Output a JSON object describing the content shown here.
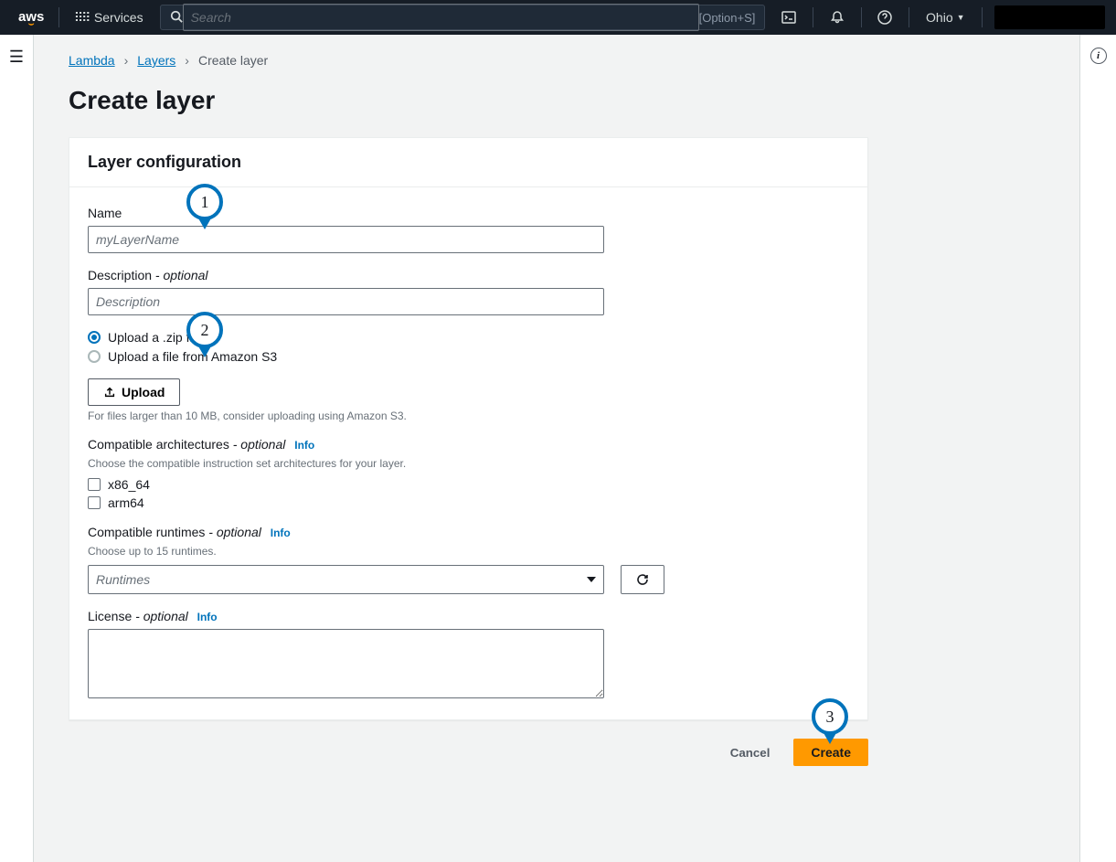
{
  "nav": {
    "services": "Services",
    "search_placeholder": "Search",
    "search_kbd": "[Option+S]",
    "region": "Ohio"
  },
  "breadcrumb": {
    "lambda": "Lambda",
    "layers": "Layers",
    "current": "Create layer"
  },
  "page_title": "Create layer",
  "panel": {
    "title": "Layer configuration",
    "name_label": "Name",
    "name_placeholder": "myLayerName",
    "desc_label": "Description",
    "desc_optional": " - optional",
    "desc_placeholder": "Description",
    "radio_zip": "Upload a .zip file",
    "radio_s3": "Upload a file from Amazon S3",
    "upload_btn": "Upload",
    "upload_hint": "For files larger than 10 MB, consider uploading using Amazon S3.",
    "arch_label": "Compatible architectures",
    "arch_optional": " - optional",
    "arch_info": "Info",
    "arch_hint": "Choose the compatible instruction set architectures for your layer.",
    "arch_x86": "x86_64",
    "arch_arm": "arm64",
    "runtimes_label": "Compatible runtimes",
    "runtimes_optional": " - optional",
    "runtimes_info": "Info",
    "runtimes_hint": "Choose up to 15 runtimes.",
    "runtimes_placeholder": "Runtimes",
    "license_label": "License",
    "license_optional": " - optional",
    "license_info": "Info"
  },
  "actions": {
    "cancel": "Cancel",
    "create": "Create"
  },
  "bubbles": {
    "b1": "1",
    "b2": "2",
    "b3": "3"
  }
}
